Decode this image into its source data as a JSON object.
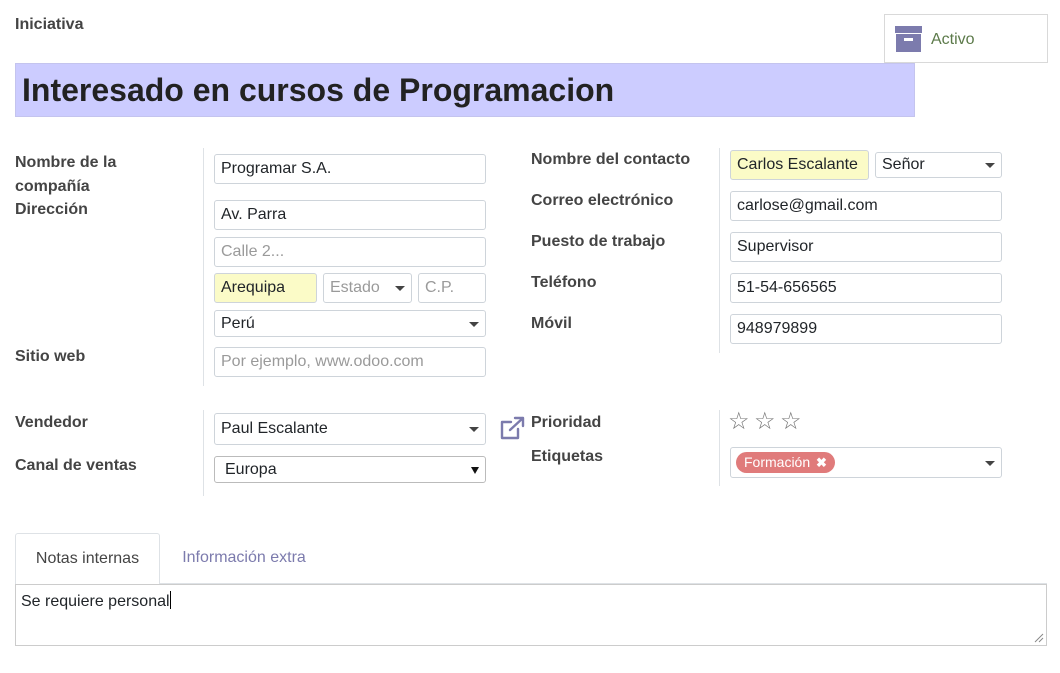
{
  "record": {
    "type_label": "Iniciativa",
    "title": "Interesado en cursos de Programacion",
    "archive_button_label": "Activo"
  },
  "left_group": {
    "company_label_line1": "Nombre de la",
    "company_label_line2": "compañía",
    "company_value": "Programar S.A.",
    "address_label": "Dirección",
    "street_value": "Av. Parra",
    "street2_placeholder": "Calle 2...",
    "city_value": "Arequipa",
    "state_placeholder": "Estado",
    "zip_placeholder": "C.P.",
    "country_value": "Perú",
    "website_label": "Sitio web",
    "website_placeholder": "Por ejemplo, www.odoo.com"
  },
  "right_group": {
    "contact_label": "Nombre del contacto",
    "contact_value": "Carlos Escalante",
    "title_value": "Señor",
    "email_label": "Correo electrónico",
    "email_value": "carlose@gmail.com",
    "job_label": "Puesto de trabajo",
    "job_value": "Supervisor",
    "phone_label": "Teléfono",
    "phone_value": "51-54-656565",
    "mobile_label": "Móvil",
    "mobile_value": "948979899"
  },
  "sales_group": {
    "salesperson_label": "Vendedor",
    "salesperson_value": "Paul Escalante",
    "channel_label": "Canal de ventas",
    "channel_value": "Europa"
  },
  "meta_group": {
    "priority_label": "Prioridad",
    "priority_value": 0,
    "priority_max": 3,
    "tags_label": "Etiquetas",
    "tags": [
      {
        "label": "Formación",
        "color": "#e07b7b"
      }
    ]
  },
  "notebook": {
    "tabs": [
      {
        "label": "Notas internas",
        "active": true
      },
      {
        "label": "Información extra",
        "active": false
      }
    ],
    "note_value": "Se requiere personal"
  },
  "colors": {
    "title_background": "#ccccff",
    "required_background": "#fbfbc7",
    "accent": "#7c7bad",
    "active_text": "#5c7a4a"
  }
}
